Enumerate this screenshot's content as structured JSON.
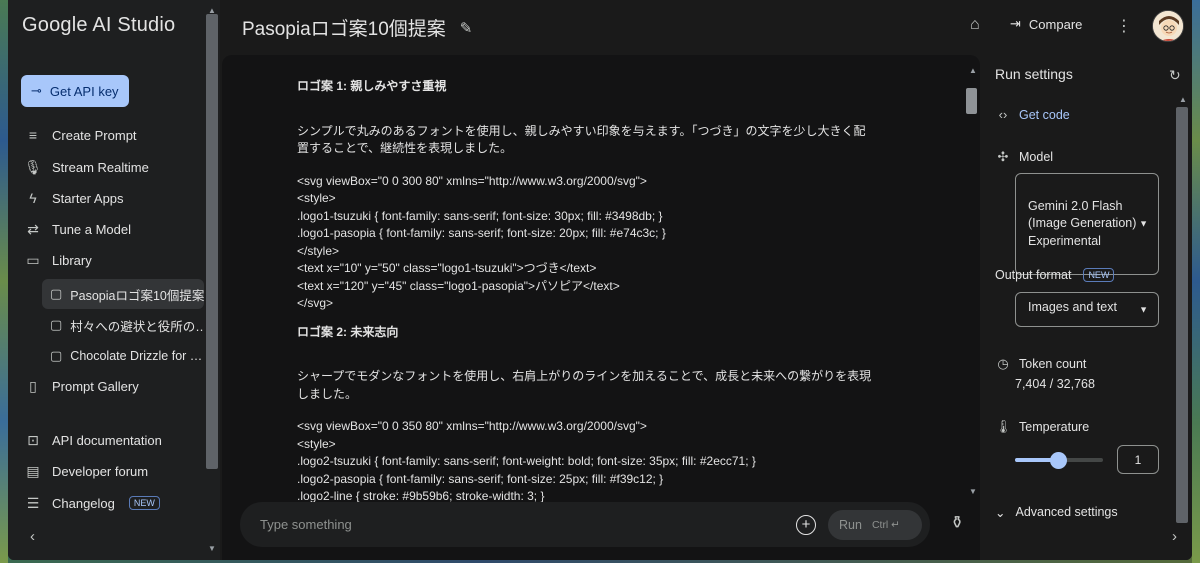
{
  "sidebar": {
    "brand": "Google AI Studio",
    "api_key_button": "Get API key",
    "nav": {
      "create_prompt": "Create Prompt",
      "stream_realtime": "Stream Realtime",
      "starter_apps": "Starter Apps",
      "tune_model": "Tune a Model",
      "library": "Library",
      "prompt_gallery": "Prompt Gallery",
      "api_docs": "API documentation",
      "developer_forum": "Developer forum",
      "changelog": "Changelog"
    },
    "library_items": [
      "Pasopiaロゴ案10個提案",
      "村々への避状と役所の…",
      "Chocolate Drizzle for …"
    ],
    "new_badge": "NEW"
  },
  "header": {
    "title": "Pasopiaロゴ案10個提案",
    "compare": "Compare"
  },
  "chat": {
    "logo1_heading": "ロゴ案 1: 親しみやすさ重視",
    "logo1_desc": "シンプルで丸みのあるフォントを使用し、親しみやすい印象を与えます。「つづき」の文字を少し大きく配\n置することで、継続性を表現しました。",
    "logo1_code": "<svg viewBox=\"0 0 300 80\" xmlns=\"http://www.w3.org/2000/svg\">\n<style>\n.logo1-tsuzuki { font-family: sans-serif; font-size: 30px; fill: #3498db; }\n.logo1-pasopia { font-family: sans-serif; font-size: 20px; fill: #e74c3c; }\n</style>\n<text x=\"10\" y=\"50\" class=\"logo1-tsuzuki\">つづき</text>\n<text x=\"120\" y=\"45\" class=\"logo1-pasopia\">パソピア</text>\n</svg>",
    "logo2_heading": "ロゴ案 2: 未来志向",
    "logo2_desc": "シャープでモダンなフォントを使用し、右肩上がりのラインを加えることで、成長と未来への繋がりを表現\nしました。",
    "logo2_code": "<svg viewBox=\"0 0 350 80\" xmlns=\"http://www.w3.org/2000/svg\">\n<style>\n.logo2-tsuzuki { font-family: sans-serif; font-weight: bold; font-size: 35px; fill: #2ecc71; }\n.logo2-pasopia { font-family: sans-serif; font-size: 25px; fill: #f39c12; }\n.logo2-line { stroke: #9b59b6; stroke-width: 3; }",
    "input_placeholder": "Type something",
    "run_label": "Run",
    "run_shortcut": "Ctrl ↵"
  },
  "settings": {
    "title": "Run settings",
    "get_code": "Get code",
    "model_label": "Model",
    "model_value": "Gemini 2.0 Flash\n(Image Generation)\nExperimental",
    "output_format_label": "Output format",
    "output_format_badge": "NEW",
    "output_format_value": "Images and text",
    "token_count_label": "Token count",
    "token_count_value": "7,404 / 32,768",
    "temperature_label": "Temperature",
    "temperature_value": "1",
    "advanced_label": "Advanced settings"
  }
}
